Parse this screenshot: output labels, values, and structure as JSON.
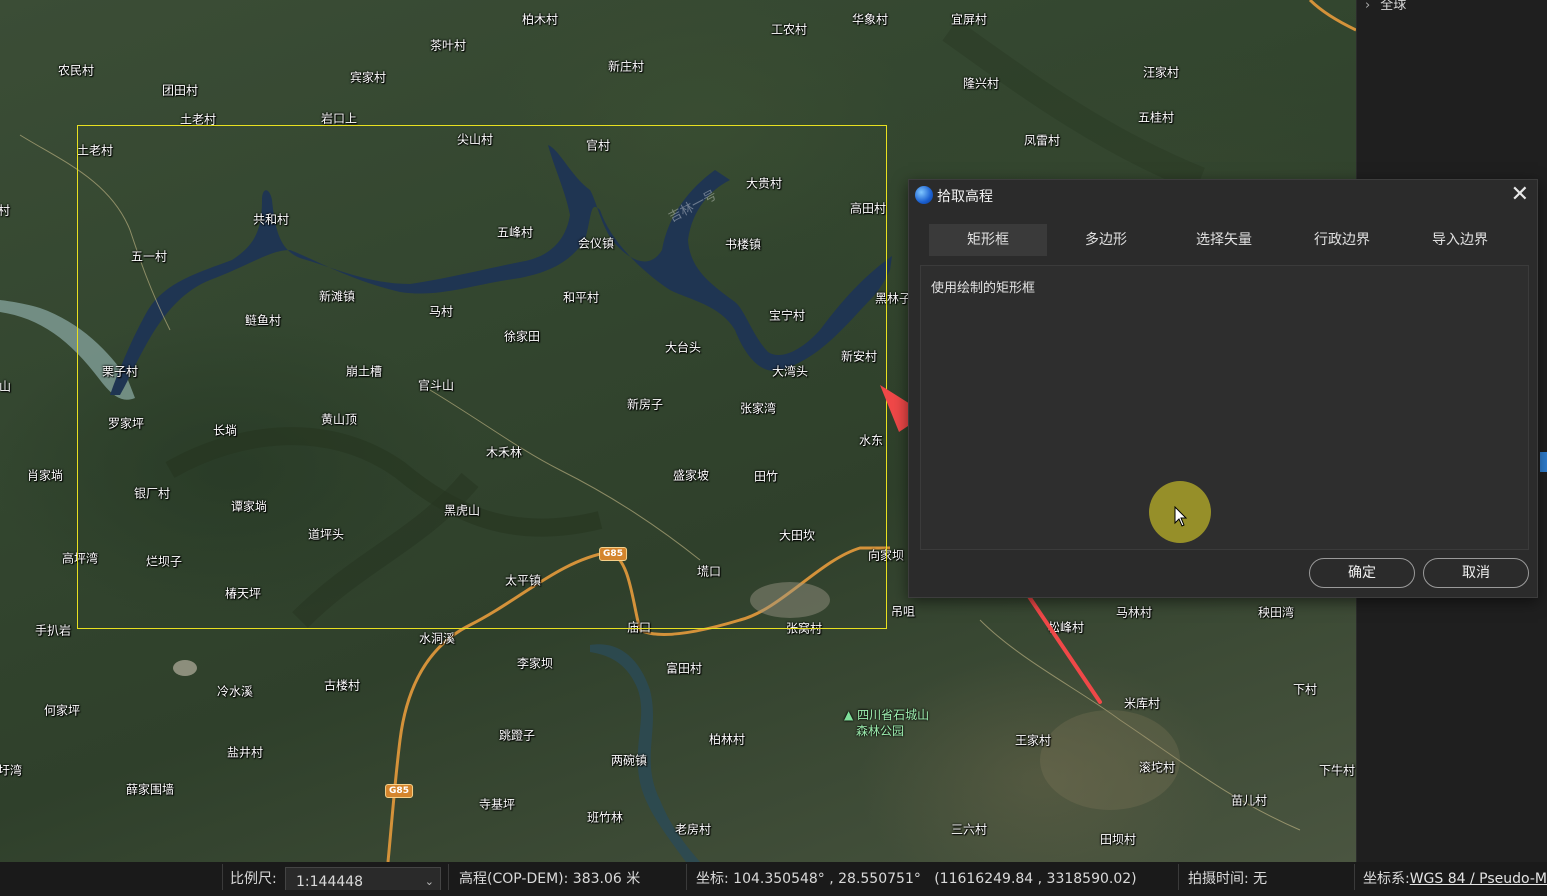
{
  "map": {
    "places": [
      {
        "name": "柏木村"
      },
      {
        "name": "茶叶村"
      },
      {
        "name": "农民村"
      },
      {
        "name": "宾家村"
      },
      {
        "name": "团田村"
      },
      {
        "name": "土老村"
      },
      {
        "name": "岩口上"
      },
      {
        "name": "新庄村"
      },
      {
        "name": "工农村"
      },
      {
        "name": "华象村"
      },
      {
        "name": "宜屏村"
      },
      {
        "name": "汪家村"
      },
      {
        "name": "隆兴村"
      },
      {
        "name": "五桂村"
      },
      {
        "name": "凤雷村"
      },
      {
        "name": "尖山村"
      },
      {
        "name": "官村"
      },
      {
        "name": "土老村"
      },
      {
        "name": "大贵村"
      },
      {
        "name": "高田村"
      },
      {
        "name": "共和村"
      },
      {
        "name": "五峰村"
      },
      {
        "name": "会仪镇"
      },
      {
        "name": "书楼镇"
      },
      {
        "name": "五一村"
      },
      {
        "name": "新滩镇"
      },
      {
        "name": "鲢鱼村"
      },
      {
        "name": "马村"
      },
      {
        "name": "和平村"
      },
      {
        "name": "徐家田"
      },
      {
        "name": "宝宁村"
      },
      {
        "name": "黑林子"
      },
      {
        "name": "大台头"
      },
      {
        "name": "栗子村"
      },
      {
        "name": "崩土槽"
      },
      {
        "name": "官斗山"
      },
      {
        "name": "大湾头"
      },
      {
        "name": "新安村"
      },
      {
        "name": "罗家坪"
      },
      {
        "name": "长埫"
      },
      {
        "name": "黄山顶"
      },
      {
        "name": "新房子"
      },
      {
        "name": "张家湾"
      },
      {
        "name": "水东"
      },
      {
        "name": "肖家埫"
      },
      {
        "name": "木禾林"
      },
      {
        "name": "银厂村"
      },
      {
        "name": "盛家坡"
      },
      {
        "name": "田竹"
      },
      {
        "name": "谭家埫"
      },
      {
        "name": "黑虎山"
      },
      {
        "name": "道坪头"
      },
      {
        "name": "大田坎"
      },
      {
        "name": "高坪湾"
      },
      {
        "name": "烂坝子"
      },
      {
        "name": "向家坝"
      },
      {
        "name": "太平镇"
      },
      {
        "name": "塃口"
      },
      {
        "name": "椿天坪"
      },
      {
        "name": "吊咀"
      },
      {
        "name": "手扒岩"
      },
      {
        "name": "水洞溪"
      },
      {
        "name": "庙口"
      },
      {
        "name": "张窝村"
      },
      {
        "name": "马林村"
      },
      {
        "name": "秧田湾"
      },
      {
        "name": "松峰村"
      },
      {
        "name": "李家坝"
      },
      {
        "name": "冷水溪"
      },
      {
        "name": "古楼村"
      },
      {
        "name": "富田村"
      },
      {
        "name": "何家坪"
      },
      {
        "name": "米库村"
      },
      {
        "name": "下村"
      },
      {
        "name": "盐井村"
      },
      {
        "name": "跳蹬子"
      },
      {
        "name": "柏林村"
      },
      {
        "name": "王家村"
      },
      {
        "name": "两碗镇"
      },
      {
        "name": "滚坨村"
      },
      {
        "name": "下牛村"
      },
      {
        "name": "薛家围墙"
      },
      {
        "name": "苗儿村"
      },
      {
        "name": "寺基坪"
      },
      {
        "name": "班竹林"
      },
      {
        "name": "老房村"
      },
      {
        "name": "三六村"
      },
      {
        "name": "田坝村"
      },
      {
        "name": "圩湾"
      },
      {
        "name": "山"
      },
      {
        "name": "村"
      }
    ],
    "road_badges": [
      "G85",
      "G85"
    ],
    "park_label_line1": "四川省石城山",
    "park_label_line2": "森林公园",
    "lake_label": "吉林一号"
  },
  "side_panel": {
    "tree_item": "全球"
  },
  "dialog": {
    "title": "拾取高程",
    "close_label": "✕",
    "tabs": [
      {
        "label": "矩形框",
        "active": true
      },
      {
        "label": "多边形",
        "active": false
      },
      {
        "label": "选择矢量",
        "active": false
      },
      {
        "label": "行政边界",
        "active": false
      },
      {
        "label": "导入边界",
        "active": false
      }
    ],
    "description": "使用绘制的矩形框",
    "ok_label": "确定",
    "cancel_label": "取消"
  },
  "statusbar": {
    "scale_label": "比例尺:",
    "scale_value": "1:144448",
    "elevation_label": "高程(COP-DEM):",
    "elevation_value": "383.06 米",
    "coord_label": "坐标:",
    "coord_value": "104.350548° , 28.550751°",
    "coord_projected": "(11616249.84 , 3318590.02)",
    "capture_time_label": "拍摄时间:",
    "capture_time_value": "无",
    "crs_label": "坐标系:",
    "crs_value": "WGS 84 / Pseudo-M"
  },
  "colors": {
    "selection_rect": "#e8e020",
    "arrow": "#f04848",
    "cursor_halo": "#b4aa28",
    "active_tab_bg": "#3a3a3a"
  }
}
